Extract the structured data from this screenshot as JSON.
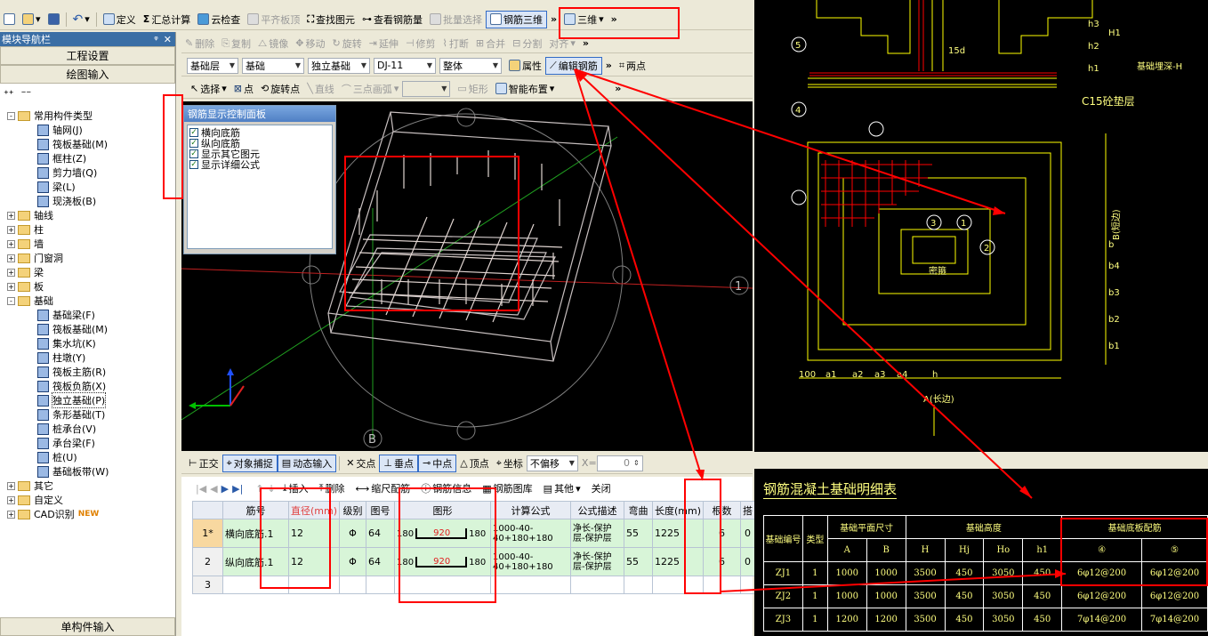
{
  "toolbar1": {
    "items": [
      "定义",
      "汇总计算",
      "云检查",
      "平齐板顶",
      "查找图元",
      "查看钢筋量",
      "批量选择",
      "钢筋三维",
      "三维"
    ]
  },
  "toolbar2": {
    "items": [
      "删除",
      "复制",
      "镜像",
      "移动",
      "旋转",
      "延伸",
      "修剪",
      "打断",
      "合并",
      "分割",
      "对齐"
    ]
  },
  "toolbar3": {
    "combos": [
      "基础层",
      "基础",
      "独立基础",
      "DJ-11",
      "整体"
    ],
    "buttons": [
      "属性",
      "编辑钢筋",
      "两点"
    ]
  },
  "toolbar4": {
    "items": [
      "选择",
      "点",
      "旋转点",
      "直线",
      "三点画弧",
      "矩形",
      "智能布置"
    ]
  },
  "nav": {
    "title": "模块导航栏",
    "btn_project": "工程设置",
    "btn_draw": "绘图输入",
    "btn_single": "单构件输入",
    "tree": [
      {
        "label": "常用构件类型",
        "level": 0,
        "type": "folder",
        "exp": "-"
      },
      {
        "label": "轴网(J)",
        "level": 1,
        "type": "item"
      },
      {
        "label": "筏板基础(M)",
        "level": 1,
        "type": "item"
      },
      {
        "label": "框柱(Z)",
        "level": 1,
        "type": "item"
      },
      {
        "label": "剪力墙(Q)",
        "level": 1,
        "type": "item"
      },
      {
        "label": "梁(L)",
        "level": 1,
        "type": "item"
      },
      {
        "label": "现浇板(B)",
        "level": 1,
        "type": "item"
      },
      {
        "label": "轴线",
        "level": 0,
        "type": "folder",
        "exp": "+"
      },
      {
        "label": "柱",
        "level": 0,
        "type": "folder",
        "exp": "+"
      },
      {
        "label": "墙",
        "level": 0,
        "type": "folder",
        "exp": "+"
      },
      {
        "label": "门窗洞",
        "level": 0,
        "type": "folder",
        "exp": "+"
      },
      {
        "label": "梁",
        "level": 0,
        "type": "folder",
        "exp": "+"
      },
      {
        "label": "板",
        "level": 0,
        "type": "folder",
        "exp": "+"
      },
      {
        "label": "基础",
        "level": 0,
        "type": "folder",
        "exp": "-"
      },
      {
        "label": "基础梁(F)",
        "level": 1,
        "type": "item"
      },
      {
        "label": "筏板基础(M)",
        "level": 1,
        "type": "item"
      },
      {
        "label": "集水坑(K)",
        "level": 1,
        "type": "item"
      },
      {
        "label": "柱墩(Y)",
        "level": 1,
        "type": "item"
      },
      {
        "label": "筏板主筋(R)",
        "level": 1,
        "type": "item"
      },
      {
        "label": "筏板负筋(X)",
        "level": 1,
        "type": "item"
      },
      {
        "label": "独立基础(P)",
        "level": 1,
        "type": "item",
        "sel": true
      },
      {
        "label": "条形基础(T)",
        "level": 1,
        "type": "item"
      },
      {
        "label": "桩承台(V)",
        "level": 1,
        "type": "item"
      },
      {
        "label": "承台梁(F)",
        "level": 1,
        "type": "item"
      },
      {
        "label": "桩(U)",
        "level": 1,
        "type": "item"
      },
      {
        "label": "基础板带(W)",
        "level": 1,
        "type": "item"
      },
      {
        "label": "其它",
        "level": 0,
        "type": "folder",
        "exp": "+"
      },
      {
        "label": "自定义",
        "level": 0,
        "type": "folder",
        "exp": "+"
      },
      {
        "label": "CAD识别",
        "level": 0,
        "type": "folder",
        "exp": "+",
        "badge": "NEW"
      }
    ]
  },
  "rebar_panel": {
    "title": "钢筋显示控制面板",
    "options": [
      "横向底筋",
      "纵向底筋",
      "显示其它图元",
      "显示详细公式"
    ]
  },
  "canvas": {
    "axis_label_1": "1",
    "axis_label_b": "B"
  },
  "snap_bar": {
    "items": [
      "正交",
      "对象捕捉",
      "动态输入",
      "交点",
      "垂点",
      "中点",
      "顶点",
      "坐标"
    ],
    "offset_mode": "不偏移",
    "x_label": "X=",
    "x_value": "0"
  },
  "grid_toolbar": {
    "items": [
      "插入",
      "删除",
      "缩尺配筋",
      "钢筋信息",
      "钢筋图库",
      "其他",
      "关闭"
    ]
  },
  "grid": {
    "headers": [
      "",
      "筋号",
      "直径(mm)",
      "级别",
      "图号",
      "图形",
      "计算公式",
      "公式描述",
      "弯曲",
      "长度(mm)",
      "根数",
      "搭"
    ],
    "rows": [
      {
        "no": "1*",
        "name": "横向底筋.1",
        "dia": "12",
        "grade": "Φ",
        "fig": "64",
        "shape_l": "180",
        "shape_m": "920",
        "shape_r": "180",
        "formula": "1000-40-40+180+180",
        "desc": "净长-保护层-保护层",
        "bend": "55",
        "len": "1225",
        "count": "6",
        "lap": "0"
      },
      {
        "no": "2",
        "name": "纵向底筋.1",
        "dia": "12",
        "grade": "Φ",
        "fig": "64",
        "shape_l": "180",
        "shape_m": "920",
        "shape_r": "180",
        "formula": "1000-40-40+180+180",
        "desc": "净长-保护层-保护层",
        "bend": "55",
        "len": "1225",
        "count": "6",
        "lap": "0"
      },
      {
        "no": "3",
        "name": "",
        "dia": "",
        "grade": "",
        "fig": "",
        "shape_l": "",
        "shape_m": "",
        "shape_r": "",
        "formula": "",
        "desc": "",
        "bend": "",
        "len": "",
        "count": "",
        "lap": ""
      }
    ]
  },
  "cad": {
    "labels": [
      "15d",
      "基础埋深-H",
      "C15砼垫层",
      "密箍",
      "A(长边)",
      "B(短边)",
      "100",
      "a1",
      "a2",
      "a3",
      "a4",
      "h",
      "b1",
      "b2",
      "b3",
      "b4",
      "b",
      "H1",
      "h1",
      "h2",
      "h3",
      "4",
      "5",
      "1",
      "2",
      "3"
    ]
  },
  "foundation_table": {
    "title": "钢筋混凝土基础明细表",
    "h_no": "基础编号",
    "h_type": "类型",
    "h_plan": "基础平面尺寸",
    "h_height": "基础高度",
    "h_reinf": "基础底板配筋",
    "sub": [
      "A",
      "B",
      "H",
      "Hj",
      "Ho",
      "h1",
      "④",
      "⑤"
    ],
    "rows": [
      [
        "ZJ1",
        "1",
        "1000",
        "1000",
        "3500",
        "450",
        "3050",
        "450",
        "6φ12@200",
        "6φ12@200"
      ],
      [
        "ZJ2",
        "1",
        "1000",
        "1000",
        "3500",
        "450",
        "3050",
        "450",
        "6φ12@200",
        "6φ12@200"
      ],
      [
        "ZJ3",
        "1",
        "1200",
        "1200",
        "3500",
        "450",
        "3050",
        "450",
        "7φ14@200",
        "7φ14@200"
      ]
    ]
  },
  "colors": {
    "highlight": "#ff0000",
    "cad_line": "#ffff00",
    "rebar": "#e8d8d0"
  }
}
